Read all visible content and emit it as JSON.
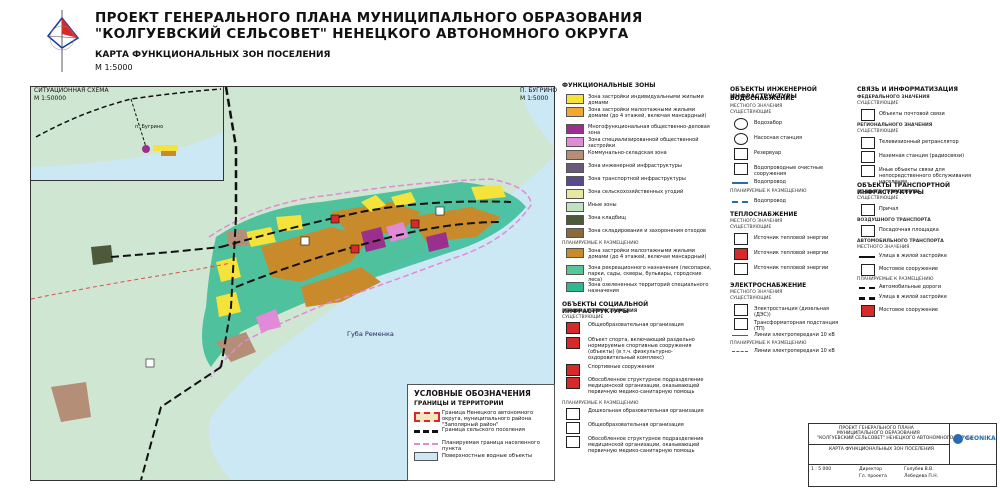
{
  "header": {
    "title_line1": "ПРОЕКТ ГЕНЕРАЛЬНОГО ПЛАНА МУНИЦИПАЛЬНОГО ОБРАЗОВАНИЯ",
    "title_line2": "\"КОЛГУЕВСКИЙ СЕЛЬСОВЕТ\" НЕНЕЦКОГО АВТОНОМНОГО ОКРУГА",
    "map_name": "КАРТА ФУНКЦИОНАЛЬНЫХ ЗОН ПОСЕЛЕНИЯ",
    "scale": "М 1:5000"
  },
  "map": {
    "inset_title": "СИТУАЦИОННАЯ СХЕМА",
    "inset_scale": "М 1:50000",
    "inset_place": "п. Бугрино",
    "village_title": "П. БУГРИНО",
    "village_scale": "М 1:5000",
    "bay_label": "Губа Ременка"
  },
  "legend_main": {
    "title": "УСЛОВНЫЕ ОБОЗНАЧЕНИЯ",
    "subtitle": "ГРАНИЦЫ И ТЕРРИТОРИИ",
    "items": [
      "Граница Ненецкого автономного округа, муниципального района \"Заполярный район\"",
      "Граница сельского поселения",
      "Планируемая граница населенного пункта",
      "Поверхностные водные объекты"
    ]
  },
  "zones": {
    "title": "ФУНКЦИОНАЛЬНЫЕ ЗОНЫ",
    "items": [
      {
        "label": "Зона застройки индивидуальными жилыми домами",
        "color": "#f5e23a"
      },
      {
        "label": "Зона застройки малоэтажными жилыми домами (до 4 этажей, включая мансардный)",
        "color": "#f0a830"
      },
      {
        "label": "Многофункциональная общественно-деловая зона",
        "color": "#9b2f8e"
      },
      {
        "label": "Зона специализированной общественной застройки",
        "color": "#e08ad8"
      },
      {
        "label": "Коммунально-складская зона",
        "color": "#b58e78"
      },
      {
        "label": "Зона инженерной инфраструктуры",
        "color": "#6a5a7a"
      },
      {
        "label": "Зона транспортной инфраструктуры",
        "color": "#5a4a8a"
      },
      {
        "label": "Зона сельскохозяйственных угодий",
        "color": "#e6e8a0"
      },
      {
        "label": "Иные зоны",
        "color": "#bfe2c0"
      },
      {
        "label": "Зона кладбищ",
        "color": "#4d5a3a"
      },
      {
        "label": "Зона складирования и захоронения отходов",
        "color": "#8a6a3a"
      }
    ],
    "planned_title": "ПЛАНИРУЕМЫЕ К РАЗМЕЩЕНИЮ",
    "planned": [
      {
        "label": "Зона застройки малоэтажными жилыми домами (до 4 этажей, включая мансардный)",
        "color": "#c88a2a"
      },
      {
        "label": "Зона рекреационного назначения (лесопарки, парки, сады, скверы, бульвары, городские леса)",
        "color": "#5cc49a"
      },
      {
        "label": "Зона озелененных территорий специального назначения",
        "color": "#2eb890"
      }
    ]
  },
  "social": {
    "title": "ОБЪЕКТЫ СОЦИАЛЬНОЙ ИНФРАСТРУКТУРЫ",
    "subtitle": "РЕГИОНАЛЬНОГО ЗНАЧЕНИЯ",
    "existing": "СУЩЕСТВУЮЩИЕ",
    "items": [
      "Общеобразовательная организация",
      "Объект спорта, включающий раздельно нормируемые спортивные сооружения (объекты) (в т.ч. физкультурно-оздоровительный комплекс)",
      "Спортивные сооружения",
      "Обособленное структурное подразделение медицинской организации, оказывающей первичную медико-санитарную помощь",
      "Дошкольная образовательная организация",
      "Общеобразовательная организация",
      "Обособленное структурное подразделение медицинской организации, оказывающей первичную медико-санитарную помощь"
    ],
    "planned_title": "ПЛАНИРУЕМЫЕ К РАЗМЕЩЕНИЮ"
  },
  "engineering": {
    "title": "ОБЪЕКТЫ ИНЖЕНЕРНОЙ ИНФРАСТРУКТУРЫ",
    "water": "ВОДОСНАБЖЕНИЕ",
    "local": "МЕСТНОГО ЗНАЧЕНИЯ",
    "existing": "СУЩЕСТВУЮЩИЕ",
    "planned": "ПЛАНИРУЕМЫЕ К РАЗМЕЩЕНИЮ",
    "water_items": [
      "Водозабор",
      "Насосная станция",
      "Резервуар",
      "Водопроводные очистные сооружения",
      "Водопровод",
      "Водопровод"
    ],
    "heat": "ТЕПЛОСНАБЖЕНИЕ",
    "heat_items": [
      "Источник тепловой энергии",
      "Источник тепловой энергии",
      "Источник тепловой энергии"
    ],
    "power": "ЭЛЕКТРОСНАБЖЕНИЕ",
    "power_items": [
      "Электростанция (дизельная (ДЭС))",
      "Трансформаторная подстанция (ТП)",
      "Линии электропередачи 10 кВ",
      "Линии электропередачи 10 кВ"
    ]
  },
  "comms": {
    "title": "СВЯЗЬ И ИНФОРМАТИЗАЦИЯ",
    "federal": "ФЕДЕРАЛЬНОГО ЗНАЧЕНИЯ",
    "existing": "СУЩЕСТВУЮЩИЕ",
    "regional": "РЕГИОНАЛЬНОГО ЗНАЧЕНИЯ",
    "items": [
      "Объекты почтовой связи",
      "Телевизионный ретранслятор",
      "Наземная станция (радиосвязи)",
      "Иные объекты связи для непосредственного обслуживания населения"
    ],
    "transport_title": "ОБЪЕКТЫ ТРАНСПОРТНОЙ ИНФРАСТРУКТУРЫ",
    "water_transport": "ВОДНОГО ТРАНСПОРТА",
    "air_transport": "ВОЗДУШНОГО ТРАНСПОРТА",
    "auto_transport": "АВТОМОБИЛЬНОГО ТРАНСПОРТА",
    "local": "МЕСТНОГО ЗНАЧЕНИЯ",
    "transport_items": [
      "Причал",
      "Посадочная площадка",
      "Улица в жилой застройке",
      "Мостовое сооружение",
      "Автомобильные дороги",
      "Улица в жилой застройке",
      "Мостовое сооружение"
    ],
    "planned": "ПЛАНИРУЕМЫЕ К РАЗМЕЩЕНИЮ"
  },
  "stamp": {
    "line1": "ПРОЕКТ ГЕНЕРАЛЬНОГО ПЛАНА",
    "line2": "МУНИЦИПАЛЬНОГО ОБРАЗОВАНИЯ",
    "line3": "\"КОЛГУЕВСКИЙ СЕЛЬСОВЕТ\" НЕНЕЦКОГО АВТОНОМНОГО ОКРУГА",
    "sheet": "КАРТА ФУНКЦИОНАЛЬНЫХ ЗОН ПОСЕЛЕНИЯ",
    "logo": "GEONIKA",
    "scale": "1 : 5 000",
    "role1": "Директор",
    "role2": "Гл. проекта",
    "name1": "Голубев В.В.",
    "name2": "Лебедева П.Н."
  }
}
